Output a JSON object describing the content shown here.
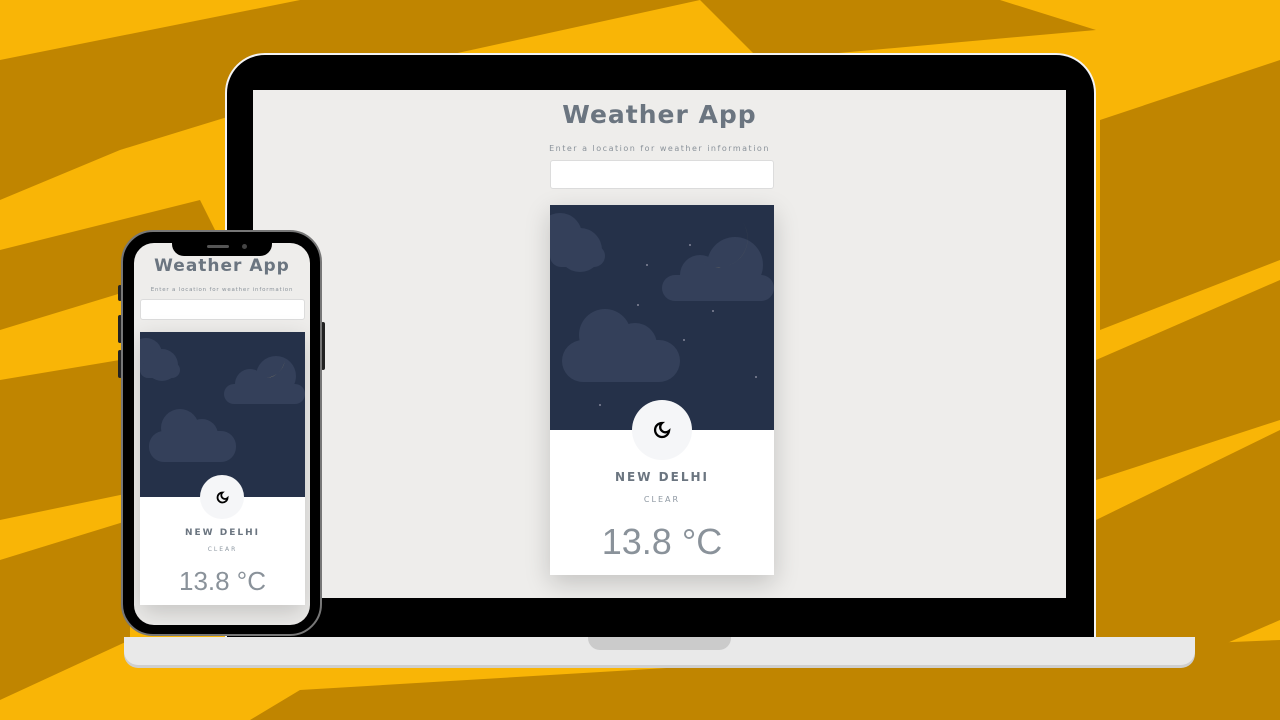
{
  "app": {
    "title": "Weather App",
    "search_label": "Enter a location for weather information",
    "search_value": "",
    "weather": {
      "city": "NEW DELHI",
      "condition": "CLEAR",
      "temperature": "13.8 °C",
      "icon": "night-clear-icon"
    }
  },
  "colors": {
    "background": "#F9B506",
    "brush": "#C08500",
    "sky": "#253149",
    "moon": "#F8D676"
  }
}
